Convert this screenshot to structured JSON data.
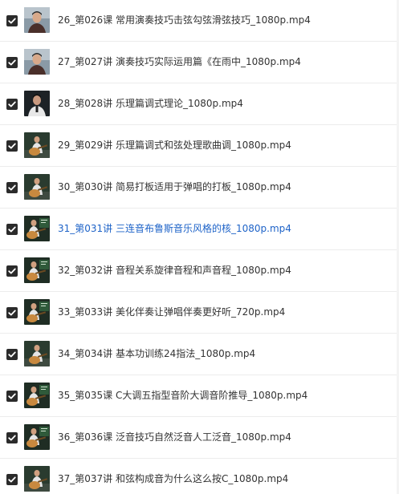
{
  "file_list": {
    "items": [
      {
        "name": "26_第026课 常用演奏技巧击弦勾弦滑弦技巧_1080p.mp4",
        "checked": true,
        "thumb": "man-portrait"
      },
      {
        "name": "27_第027讲 演奏技巧实际运用篇《在雨中_1080p.mp4",
        "checked": true,
        "thumb": "man-portrait"
      },
      {
        "name": "28_第028讲 乐理篇调式理论_1080p.mp4",
        "checked": true,
        "thumb": "man-dark"
      },
      {
        "name": "29_第029讲 乐理篇调式和弦处理歌曲调_1080p.mp4",
        "checked": true,
        "thumb": "guitar-player"
      },
      {
        "name": "30_第030讲 简易打板适用于弹唱的打板_1080p.mp4",
        "checked": true,
        "thumb": "guitar-player"
      },
      {
        "name": "31_第031讲 三连音布鲁斯音乐风格的核_1080p.mp4",
        "checked": true,
        "thumb": "guitar-player-board",
        "selected": true
      },
      {
        "name": "32_第032讲 音程关系旋律音程和声音程_1080p.mp4",
        "checked": true,
        "thumb": "guitar-player-board"
      },
      {
        "name": "33_第033讲 美化伴奏让弹唱伴奏更好听_720p.mp4",
        "checked": true,
        "thumb": "guitar-player-board"
      },
      {
        "name": "34_第034讲 基本功训练24指法_1080p.mp4",
        "checked": true,
        "thumb": "guitar-player"
      },
      {
        "name": "35_第035课 C大调五指型音阶大调音阶推导_1080p.mp4",
        "checked": true,
        "thumb": "guitar-player-board"
      },
      {
        "name": "36_第036课 泛音技巧自然泛音人工泛音_1080p.mp4",
        "checked": true,
        "thumb": "guitar-player-board"
      },
      {
        "name": "37_第037讲 和弦构成音为什么这么按C_1080p.mp4",
        "checked": true,
        "thumb": "guitar-player"
      }
    ]
  },
  "colors": {
    "checkbox_fill": "#2b2b2b",
    "text_default": "#333333",
    "text_selected": "#1e63c8",
    "row_divider": "#ececec"
  },
  "icons": {
    "checkbox": "checkmark-icon",
    "thumbnail": "video-thumbnail-icon"
  }
}
